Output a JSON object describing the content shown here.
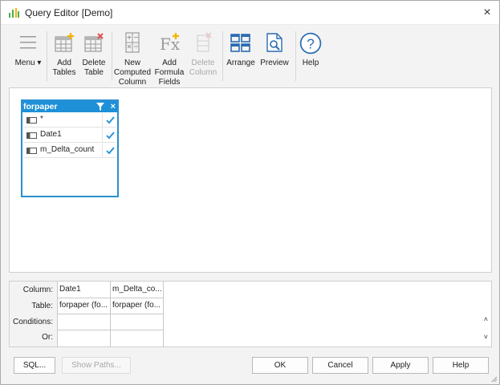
{
  "window": {
    "title": "Query Editor [Demo]",
    "close_glyph": "×"
  },
  "toolbar": {
    "menu": "Menu ▾",
    "add_tables": "Add\nTables",
    "delete_table": "Delete\nTable",
    "new_computed_column": "New\nComputed\nColumn",
    "add_formula_fields": "Add\nFormula\nFields",
    "delete_column": "Delete\nColumn",
    "arrange": "Arrange",
    "preview": "Preview",
    "help": "Help"
  },
  "table_box": {
    "name": "forpaper",
    "close_glyph": "×",
    "fields": [
      {
        "name": "*",
        "checked": true
      },
      {
        "name": "Date1",
        "checked": true
      },
      {
        "name": "m_Delta_count",
        "checked": true
      }
    ]
  },
  "grid": {
    "labels": {
      "column": "Column:",
      "table": "Table:",
      "conditions": "Conditions:",
      "or": "Or:"
    },
    "columns": [
      {
        "column": "Date1",
        "table": "forpaper (fo..."
      },
      {
        "column": "m_Delta_co...",
        "table": "forpaper (fo..."
      }
    ],
    "scroll_up": "˄",
    "scroll_down": "˅"
  },
  "buttons": {
    "sql": "SQL...",
    "show_paths": "Show Paths...",
    "ok": "OK",
    "cancel": "Cancel",
    "apply": "Apply",
    "help": "Help"
  },
  "colors": {
    "accent": "#1e90d8",
    "icon_blue": "#2b6cb0",
    "icon_gray": "#9a9a9a",
    "icon_plus": "#f4b400",
    "icon_red": "#e05050"
  }
}
